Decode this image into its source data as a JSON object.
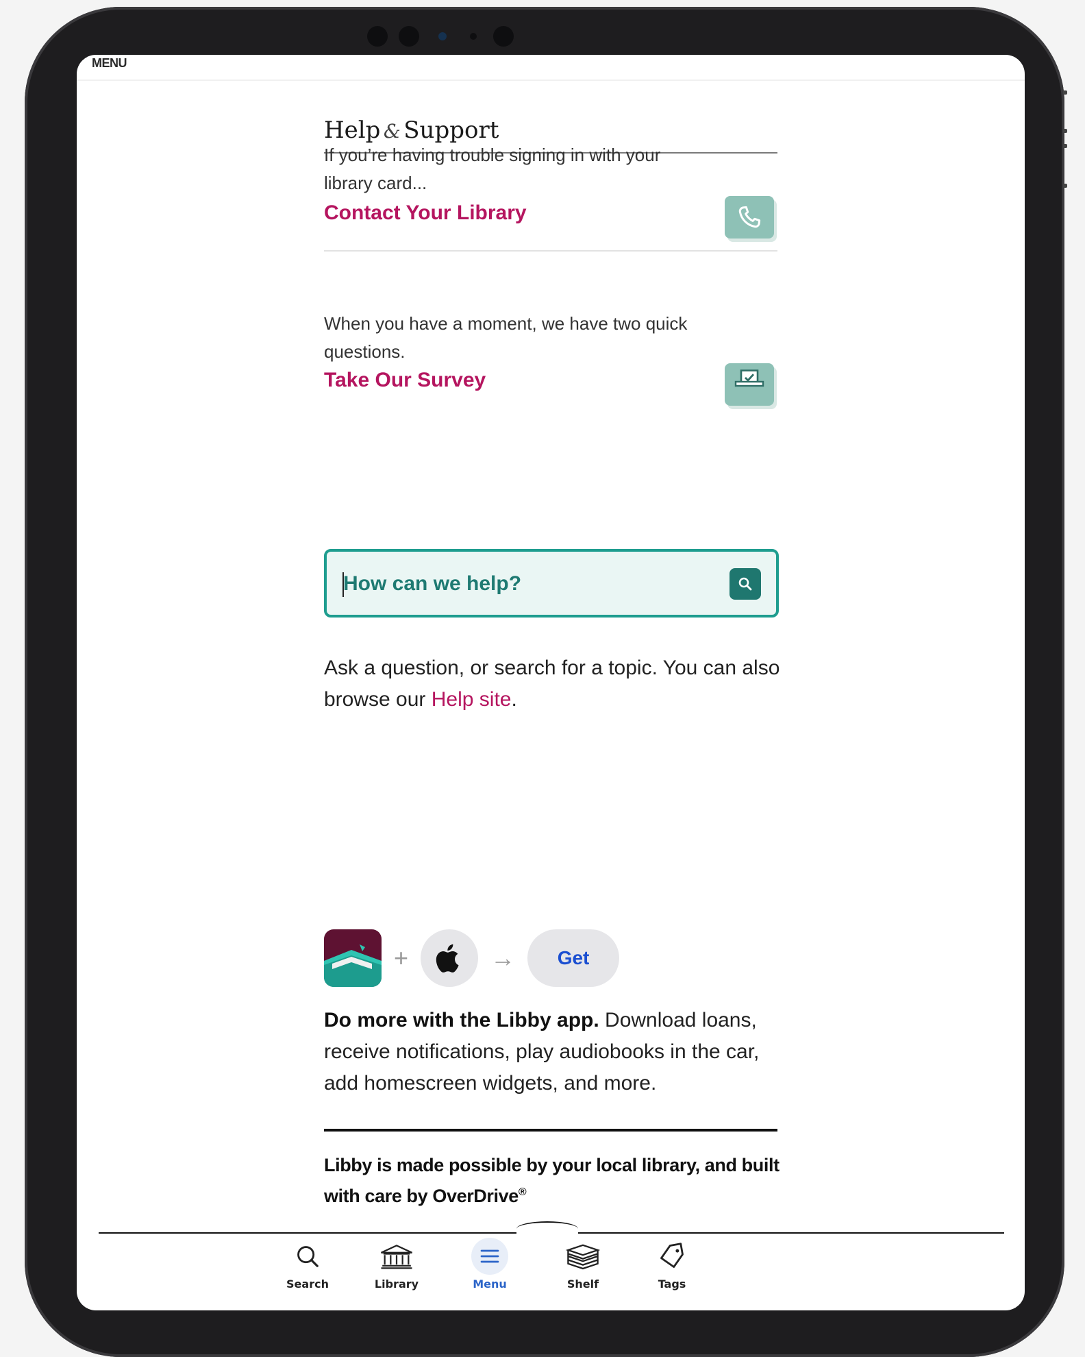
{
  "header": {
    "menu_label": "MENU"
  },
  "help": {
    "title_part1": "Help",
    "title_amp": "&",
    "title_part2": "Support",
    "contact_text": "If you’re having trouble signing in with your library card...",
    "contact_link": "Contact Your Library",
    "contact_icon": "phone-icon",
    "survey_text": "When you have a moment, we have two quick questions.",
    "survey_link": "Take Our Survey",
    "survey_icon": "survey-ballot-icon"
  },
  "search": {
    "placeholder": "How can we help?",
    "button_icon": "search-icon",
    "ask_text_before": "Ask a question, or search for a topic. You can also browse our ",
    "ask_link": "Help site",
    "ask_text_after": "."
  },
  "app_promo": {
    "plus": "+",
    "arrow": "→",
    "get_label": "Get",
    "bold_text": "Do more with the Libby app.",
    "text": " Download loans, receive notifications, play audiobooks in the car, add homescreen widgets, and more.",
    "credit_text": "Libby is made possible by your local library, and built with care by OverDrive",
    "credit_mark": "®"
  },
  "nav": {
    "active": "Menu",
    "items": [
      {
        "label": "Search",
        "icon": "search-icon"
      },
      {
        "label": "Library",
        "icon": "library-building-icon"
      },
      {
        "label": "Menu",
        "icon": "menu-icon"
      },
      {
        "label": "Shelf",
        "icon": "shelf-books-icon"
      },
      {
        "label": "Tags",
        "icon": "tag-icon"
      }
    ]
  },
  "colors": {
    "accent_pink": "#b5155f",
    "teal": "#1e9d8f",
    "teal_tile": "#8ec1b6",
    "active_blue": "#2b64c8"
  }
}
